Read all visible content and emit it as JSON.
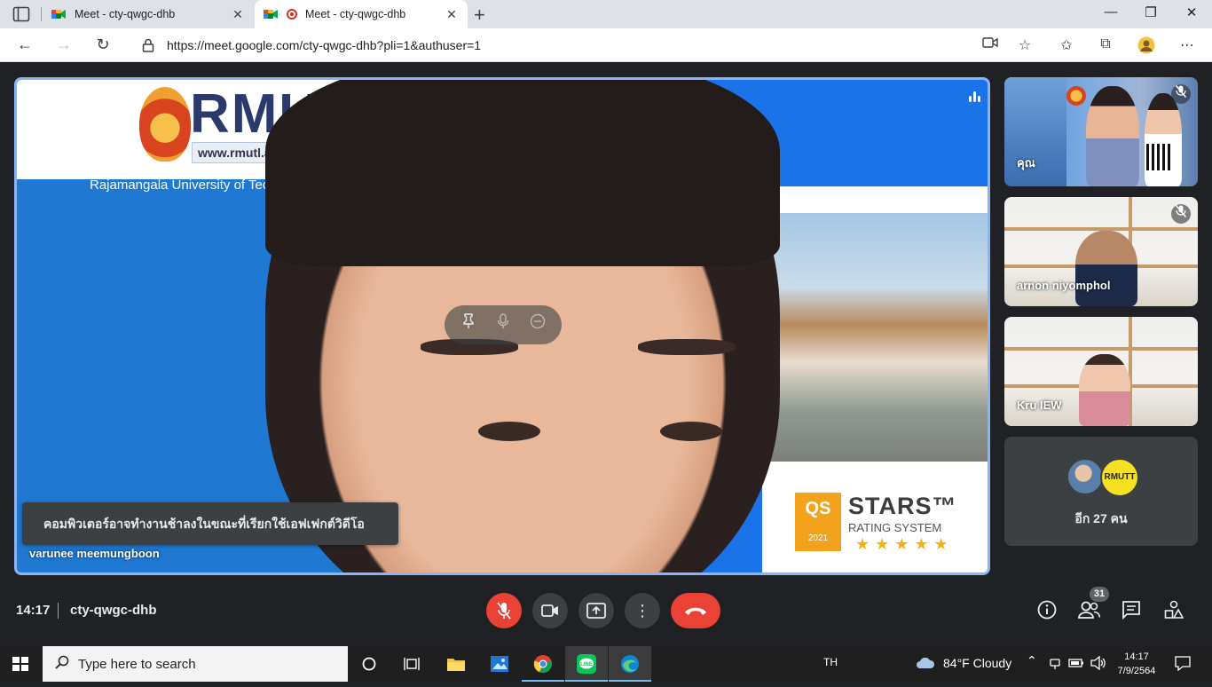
{
  "browser": {
    "tabs": [
      {
        "title": "Meet - cty-qwgc-dhb",
        "active": false
      },
      {
        "title": "Meet - cty-qwgc-dhb",
        "active": true
      }
    ],
    "url": "https://meet.google.com/cty-qwgc-dhb?pli=1&authuser=1",
    "close_glyph": "✕",
    "new_tab_glyph": "+"
  },
  "main_video": {
    "speaker_name": "varunee meemungboon",
    "slide_logo": "RMUT",
    "slide_url": "www.rmutl.ac.th",
    "slide_subtitle": "Rajamangala University of Tec",
    "qs_box": "QS",
    "qs_stars": "STARS™",
    "qs_rating": "RATING SYSTEM",
    "qs_year": "2021",
    "qs_gold": "★★★★★",
    "notice": "คอมพิวเตอร์อาจทำงานช้าลงในขณะที่เรียกใช้เอฟเฟกต์วิดีโอ"
  },
  "tiles": [
    {
      "name": "คุณ",
      "muted": true
    },
    {
      "name": "arnon niyomphol",
      "muted": true
    },
    {
      "name": "Kru IEW",
      "muted": false
    },
    {
      "more_label": "อีก 27 คน",
      "avatar2_text": "RMUTT"
    }
  ],
  "meet_bar": {
    "time": "14:17",
    "meeting_code": "cty-qwgc-dhb",
    "participant_count": "31"
  },
  "taskbar": {
    "search_placeholder": "Type here to search",
    "lang": "TH",
    "weather": "84°F  Cloudy",
    "time": "14:17",
    "date": "7/9/2564"
  },
  "colors": {
    "accent": "#8ab4f8",
    "end_call": "#ea4335",
    "meet_bg": "#202124"
  }
}
